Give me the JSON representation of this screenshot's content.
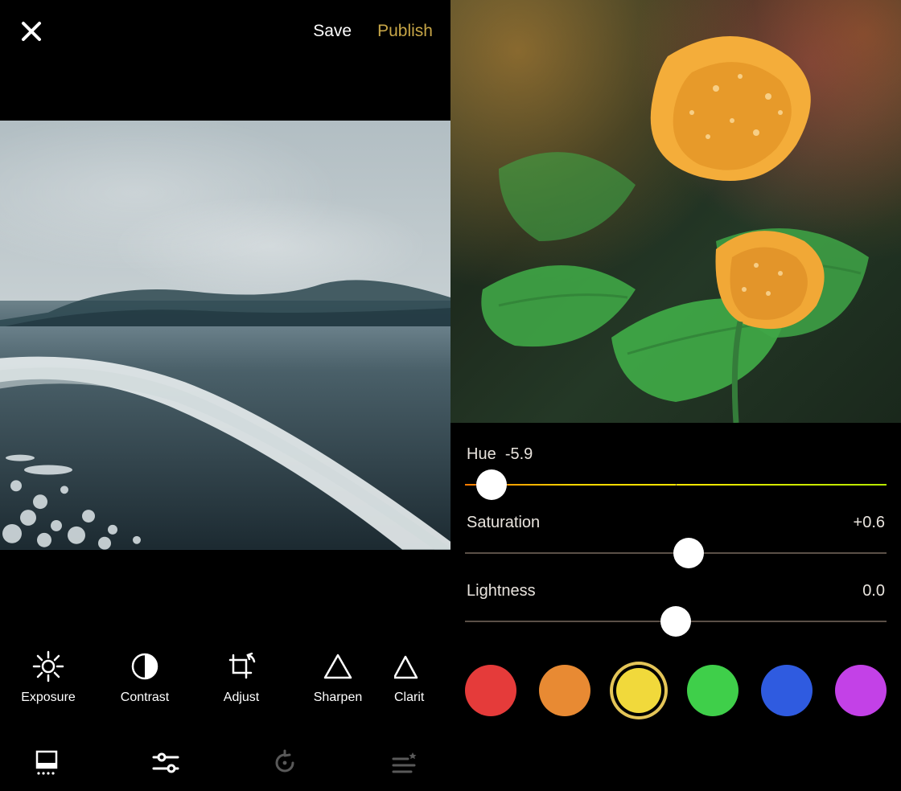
{
  "left": {
    "header": {
      "close_icon": "close-icon",
      "save_label": "Save",
      "publish_label": "Publish"
    },
    "tools": [
      {
        "id": "exposure",
        "label": "Exposure",
        "icon": "sun-icon"
      },
      {
        "id": "contrast",
        "label": "Contrast",
        "icon": "half-circle-icon"
      },
      {
        "id": "adjust",
        "label": "Adjust",
        "icon": "crop-rotate-icon"
      },
      {
        "id": "sharpen",
        "label": "Sharpen",
        "icon": "triangle-icon"
      },
      {
        "id": "clarity",
        "label": "Clarit",
        "icon": "double-triangle-icon"
      }
    ],
    "bottombar": [
      {
        "id": "frames",
        "icon": "frame-dots-icon",
        "active": true,
        "interactable": true
      },
      {
        "id": "sliders",
        "icon": "sliders-icon",
        "active": true,
        "interactable": true
      },
      {
        "id": "reset",
        "icon": "reset-icon",
        "active": false,
        "interactable": false
      },
      {
        "id": "levels",
        "icon": "levels-star-icon",
        "active": false,
        "interactable": false
      }
    ]
  },
  "right": {
    "sliders": {
      "hue": {
        "label": "Hue",
        "value_text": "-5.9",
        "position_pct": 7
      },
      "saturation": {
        "label": "Saturation",
        "value_text": "+0.6",
        "position_pct": 53
      },
      "lightness": {
        "label": "Lightness",
        "value_text": "0.0",
        "position_pct": 50
      }
    },
    "swatches": [
      {
        "id": "red",
        "color": "#e53b3a",
        "selected": false
      },
      {
        "id": "orange",
        "color": "#e88a33",
        "selected": false
      },
      {
        "id": "yellow",
        "color": "#f1d93b",
        "selected": true
      },
      {
        "id": "green",
        "color": "#3fcf4a",
        "selected": false
      },
      {
        "id": "blue",
        "color": "#2f5be0",
        "selected": false
      },
      {
        "id": "magenta",
        "color": "#c341e7",
        "selected": false
      }
    ]
  }
}
